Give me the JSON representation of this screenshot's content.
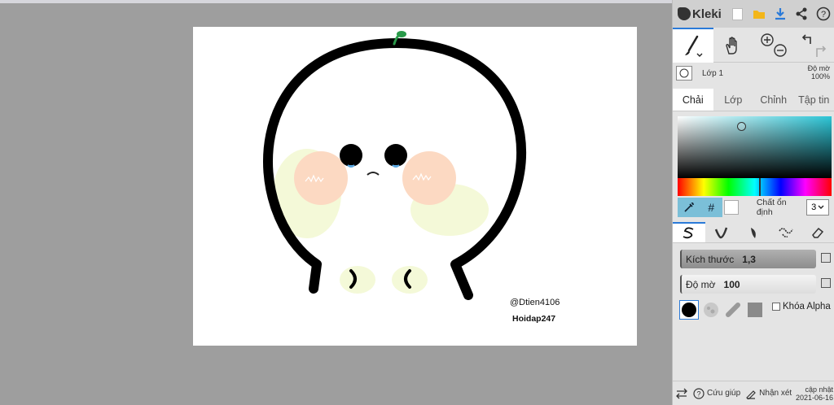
{
  "app": {
    "name": "Kleki"
  },
  "canvas": {
    "watermark_handle": "@Dtien4106",
    "watermark_site": "Hoidap247"
  },
  "icons": {
    "new": "new-image-icon",
    "open": "folder-icon",
    "save": "download-icon",
    "share": "share-icon",
    "help": "help-icon",
    "brush": "brush-icon",
    "hand": "hand-icon",
    "zoom_in": "zoom-in-icon",
    "zoom_out": "zoom-out-icon",
    "undo": "undo-icon",
    "redo": "redo-icon"
  },
  "layer": {
    "name": "Lớp 1",
    "opacity_label": "Độ mờ",
    "opacity_value": "100%"
  },
  "tabs": [
    {
      "label": "Chải",
      "active": true
    },
    {
      "label": "Lớp",
      "active": false
    },
    {
      "label": "Chỉnh",
      "active": false
    },
    {
      "label": "Tập tin",
      "active": false
    }
  ],
  "color": {
    "hash_label": "#",
    "stabilizer_label": "Chất ổn định",
    "stabilizer_value": "3",
    "accent": "#2a7ad8"
  },
  "brush": {
    "size_label": "Kích thước",
    "size_value": "1,3",
    "opacity_label": "Độ mờ",
    "opacity_value": "100",
    "alpha_lock_label": "Khóa Alpha"
  },
  "footer": {
    "help_label": "Cứu giúp",
    "feedback_label": "Nhận xét",
    "update_label": "cập nhật",
    "update_date": "2021-06-16"
  }
}
